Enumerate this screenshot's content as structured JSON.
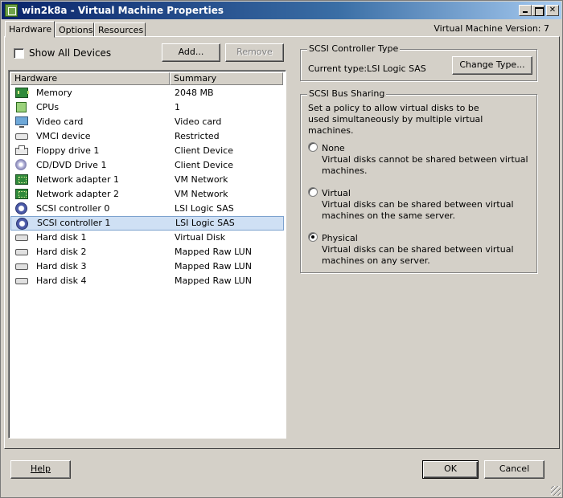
{
  "window": {
    "title": "win2k8a - Virtual Machine Properties"
  },
  "tabs": [
    {
      "label": "Hardware",
      "active": true
    },
    {
      "label": "Options",
      "active": false
    },
    {
      "label": "Resources",
      "active": false
    }
  ],
  "version_label": "Virtual Machine Version: 7",
  "show_all_devices": {
    "label": "Show All Devices",
    "checked": false
  },
  "buttons": {
    "add": "Add...",
    "remove": "Remove",
    "change_type": "Change Type...",
    "help": "Help",
    "ok": "OK",
    "cancel": "Cancel"
  },
  "hardware_table": {
    "columns": [
      "Hardware",
      "Summary"
    ],
    "rows": [
      {
        "name": "Memory",
        "summary": "2048 MB",
        "icon": "memory-icon"
      },
      {
        "name": "CPUs",
        "summary": "1",
        "icon": "cpu-icon"
      },
      {
        "name": "Video card",
        "summary": "Video card",
        "icon": "monitor-icon"
      },
      {
        "name": "VMCI device",
        "summary": "Restricted",
        "icon": "device-icon"
      },
      {
        "name": "Floppy drive 1",
        "summary": "Client Device",
        "icon": "floppy-icon"
      },
      {
        "name": "CD/DVD Drive 1",
        "summary": "Client Device",
        "icon": "cd-icon"
      },
      {
        "name": "Network adapter 1",
        "summary": "VM Network",
        "icon": "network-icon"
      },
      {
        "name": "Network adapter 2",
        "summary": "VM Network",
        "icon": "network-icon"
      },
      {
        "name": "SCSI controller 0",
        "summary": "LSI Logic SAS",
        "icon": "scsi-icon"
      },
      {
        "name": "SCSI controller 1",
        "summary": "LSI Logic SAS",
        "icon": "scsi-icon",
        "selected": true
      },
      {
        "name": "Hard disk 1",
        "summary": "Virtual Disk",
        "icon": "disk-icon"
      },
      {
        "name": "Hard disk 2",
        "summary": "Mapped Raw LUN",
        "icon": "disk-icon"
      },
      {
        "name": "Hard disk 3",
        "summary": "Mapped Raw LUN",
        "icon": "disk-icon"
      },
      {
        "name": "Hard disk 4",
        "summary": "Mapped Raw LUN",
        "icon": "disk-icon"
      }
    ]
  },
  "controller_type": {
    "title": "SCSI Controller Type",
    "current_label": "Current type:",
    "current_value": "LSI Logic SAS"
  },
  "bus_sharing": {
    "title": "SCSI Bus Sharing",
    "description": "Set a policy to allow virtual disks to be used simultaneously by multiple virtual machines.",
    "options": [
      {
        "label": "None",
        "description": "Virtual disks cannot be shared between virtual machines.",
        "checked": false
      },
      {
        "label": "Virtual",
        "description": "Virtual disks can be shared between virtual machines on the same server.",
        "checked": false
      },
      {
        "label": "Physical",
        "description": "Virtual disks can be shared between virtual machines on any server.",
        "checked": true
      }
    ]
  },
  "colors": {
    "selection_fill": "#cfe0f4",
    "selection_border": "#7da2ce",
    "titlebar": "#0a246a"
  }
}
